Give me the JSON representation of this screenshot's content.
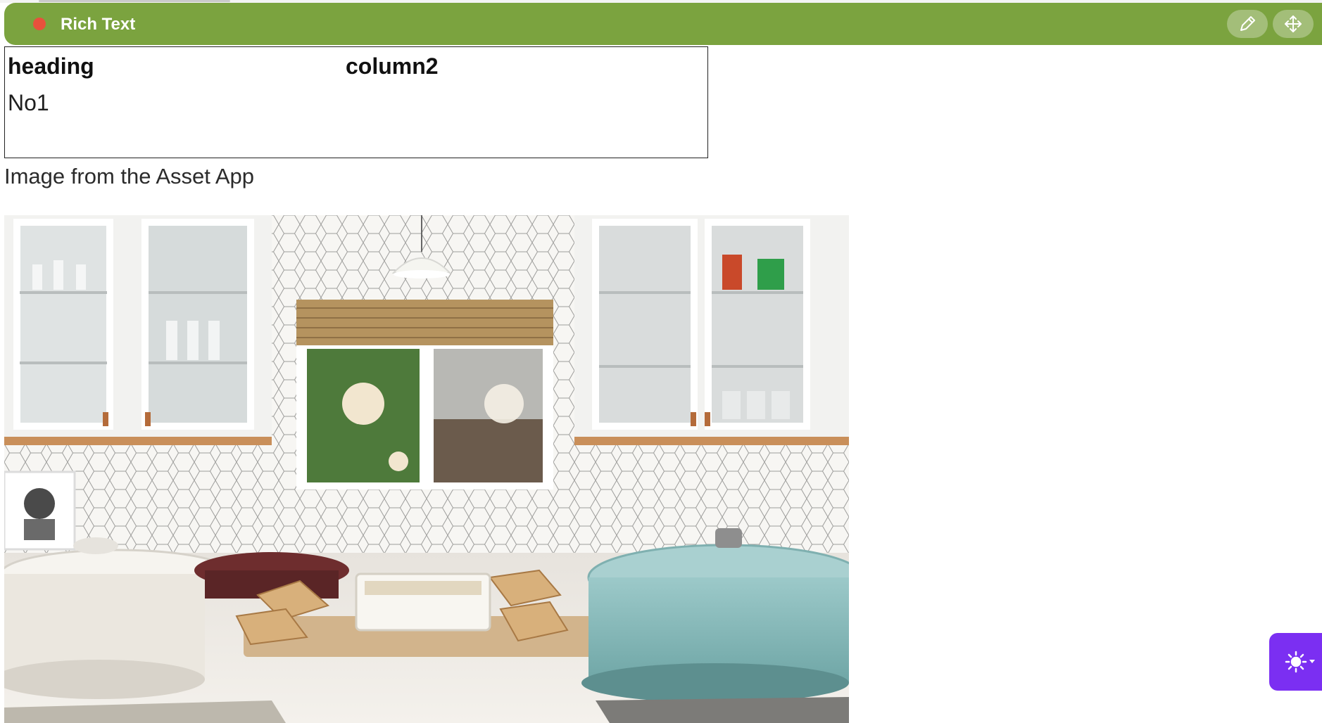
{
  "topbar": {
    "title": "Rich Text",
    "status_color": "#e8513c",
    "accent_color": "#7ba33f",
    "edit_icon": "pencil-icon",
    "move_icon": "move-arrows-icon"
  },
  "table": {
    "headers": [
      "heading",
      "column2"
    ],
    "rows": [
      [
        "No1",
        ""
      ]
    ]
  },
  "caption": "Image from the Asset App",
  "image": {
    "subject": "kitchen-photo"
  },
  "theme_toggle": {
    "icon": "sun-icon",
    "color": "#7b2ff2"
  }
}
